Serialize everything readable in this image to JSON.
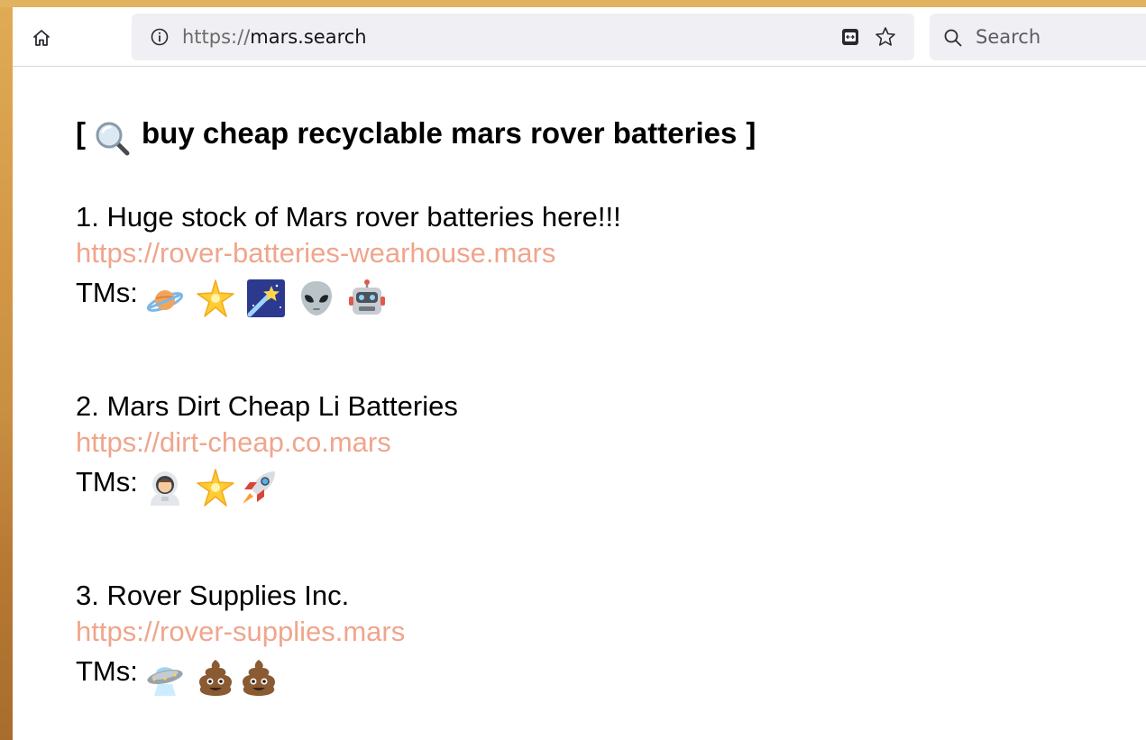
{
  "browser": {
    "url_scheme": "https://",
    "url_host": "mars.search",
    "search_placeholder": "Search"
  },
  "page": {
    "query_prefix": "[",
    "query_text": "buy cheap recyclable mars rover batteries",
    "query_suffix": "]",
    "link_color": "#f0a58c",
    "results": [
      {
        "title": "1. Huge stock of Mars rover batteries here!!!",
        "url": "https://rover-batteries-wearhouse.mars",
        "tms_label": "TMs:",
        "tms": [
          "ringed-planet-emoji",
          "glowing-star-emoji",
          "shooting-star-emoji",
          "alien-emoji",
          "robot-emoji"
        ]
      },
      {
        "title": "2. Mars Dirt Cheap Li Batteries",
        "url": "https://dirt-cheap.co.mars",
        "tms_label": "TMs:",
        "tms": [
          "astronaut-emoji",
          "glowing-star-emoji",
          "rocket-emoji"
        ]
      },
      {
        "title": "3. Rover Supplies Inc.",
        "url": "https://rover-supplies.mars",
        "tms_label": "TMs:",
        "tms": [
          "flying-saucer-emoji",
          "pile-of-poo-emoji",
          "pile-of-poo-emoji"
        ]
      }
    ]
  }
}
